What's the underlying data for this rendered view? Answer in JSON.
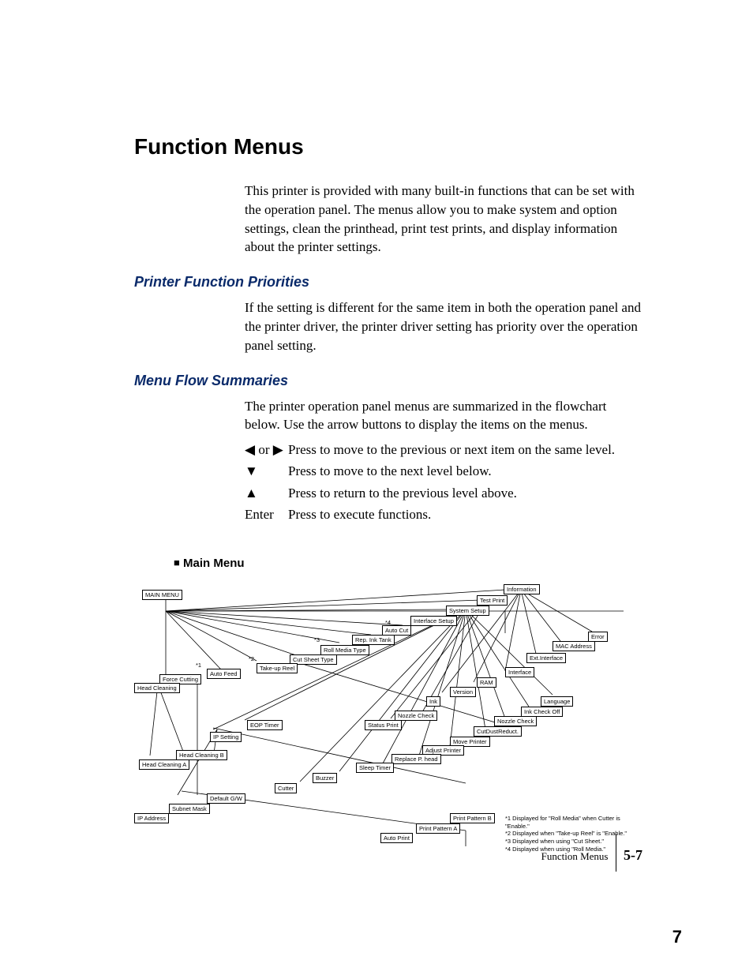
{
  "title": "Function Menus",
  "intro": "This printer is provided with many built-in functions that can be set with the operation panel. The menus allow you to make system and option settings, clean the printhead, print test prints, and display information about the printer settings.",
  "section_priorities_title": "Printer Function Priorities",
  "priorities_body": "If the setting is different for the same item in both the operation panel and the printer driver, the printer driver setting has priority over the operation panel setting.",
  "section_flow_title": "Menu Flow Summaries",
  "flow_body_1": "The printer operation panel menus are summarized in the flowchart below. Use the arrow buttons to display the items on the menus.",
  "arrows": {
    "lr_sym": "◀ or ▶",
    "lr_desc": "Press  to move to the previous or next item on the same level.",
    "down_sym": "▼",
    "down_desc": "Press to move to the next level below.",
    "up_sym": "▲",
    "up_desc": "Press to return to the previous level above.",
    "enter_sym": "Enter",
    "enter_desc": "Press to execute functions."
  },
  "diagram_heading": "Main Menu",
  "nodes": {
    "main_menu": "MAIN MENU",
    "head_cleaning": "Head Cleaning",
    "force_cutting": "Force Cutting",
    "n1": "*1",
    "auto_feed": "Auto Feed",
    "n2": "*2",
    "take_up_reel": "Take-up Reel",
    "n3": "*3",
    "cut_sheet_type": "Cut Sheet Type",
    "roll_media_type": "Roll Media Type",
    "rep_ink_tank": "Rep. Ink Tank",
    "auto_cut": "Auto Cut",
    "n4": "*4",
    "interface_setup": "Interface Setup",
    "system_setup": "System Setup",
    "test_print": "Test Print",
    "information": "Information",
    "error": "Error",
    "mac_address": "MAC Address",
    "ext_interface": "Ext.Interface",
    "interface": "Interface",
    "ram": "RAM",
    "version": "Version",
    "ink": "Ink",
    "language": "Language",
    "ink_check_off": "Ink Check Off",
    "nozzle_check2": "Nozzle Check",
    "cutdust": "CutDustReduct.",
    "move_printer": "Move Printer",
    "adjust_printer": "Adjust Printer",
    "replace_phead": "Replace P. head",
    "sleep_timer": "Sleep Timer",
    "buzzer": "Buzzer",
    "cutter": "Cutter",
    "default_gw": "Default G/W",
    "subnet_mask": "Subnet Mask",
    "ip_address": "IP Address",
    "ip_setting": "IP Setting",
    "eop_timer": "EOP Timer",
    "nozzle_check": "Nozzle Check",
    "status_print": "Status Print",
    "head_cleaning_a": "Head Cleaning A",
    "head_cleaning_b": "Head Cleaning B",
    "auto_print": "Auto Print",
    "print_pattern_a": "Print Pattern A",
    "print_pattern_b": "Print Pattern B"
  },
  "footnotes": {
    "f1": "*1  Displayed for \"Roll Media\" when Cutter is \"Enable.\"",
    "f2": "*2  Displayed when \"Take-up Reel\" is \"Enable.\"",
    "f3": "*3  Displayed when using \"Cut Sheet.\"",
    "f4": "*4  Displayed when using \"Roll Media.\""
  },
  "footer_label": "Function Menus",
  "footer_page": "5-7",
  "big_page": "7"
}
